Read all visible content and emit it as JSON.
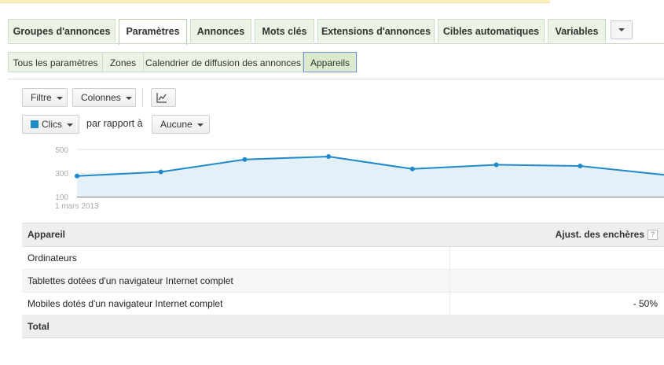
{
  "tabs": [
    {
      "label": "Groupes d'annonces",
      "active": false
    },
    {
      "label": "Paramètres",
      "active": true
    },
    {
      "label": "Annonces",
      "active": false
    },
    {
      "label": "Mots clés",
      "active": false
    },
    {
      "label": "Extensions d'annonces",
      "active": false
    },
    {
      "label": "Cibles automatiques",
      "active": false
    },
    {
      "label": "Variables",
      "active": false
    }
  ],
  "subtabs": [
    {
      "label": "Tous les paramètres",
      "active": false
    },
    {
      "label": "Zones",
      "active": false
    },
    {
      "label": "Calendrier de diffusion des annonces",
      "active": false
    },
    {
      "label": "Appareils",
      "active": true
    }
  ],
  "toolbar": {
    "filter_label": "Filtre",
    "columns_label": "Colonnes",
    "chart_toggle_icon": "line-chart-icon"
  },
  "comparison": {
    "metric_label": "Clics",
    "metric_color": "#1f8ac9",
    "compare_text": "par rapport à",
    "compare_value": "Aucune"
  },
  "chart_data": {
    "type": "area",
    "x": [
      "1 mars 2013",
      "",
      "",
      "",
      "",
      "",
      "",
      ""
    ],
    "x_tick_label": "1 mars 2013",
    "values": [
      275,
      310,
      415,
      440,
      335,
      370,
      360,
      285
    ],
    "y_ticks": [
      "500",
      "300",
      "100"
    ],
    "ylim": [
      100,
      500
    ],
    "grid": true,
    "series_color": "#1f8ac9",
    "fill_color": "#e3f0f8"
  },
  "table": {
    "col_device": "Appareil",
    "col_bid": "Ajust. des enchères",
    "help_symbol": "?",
    "rows": [
      {
        "device": "Ordinateurs",
        "bid": ""
      },
      {
        "device": "Tablettes dotées d'un navigateur Internet complet",
        "bid": ""
      },
      {
        "device": "Mobiles dotés d'un navigateur Internet complet",
        "bid": "- 50%"
      }
    ],
    "total_label": "Total"
  }
}
